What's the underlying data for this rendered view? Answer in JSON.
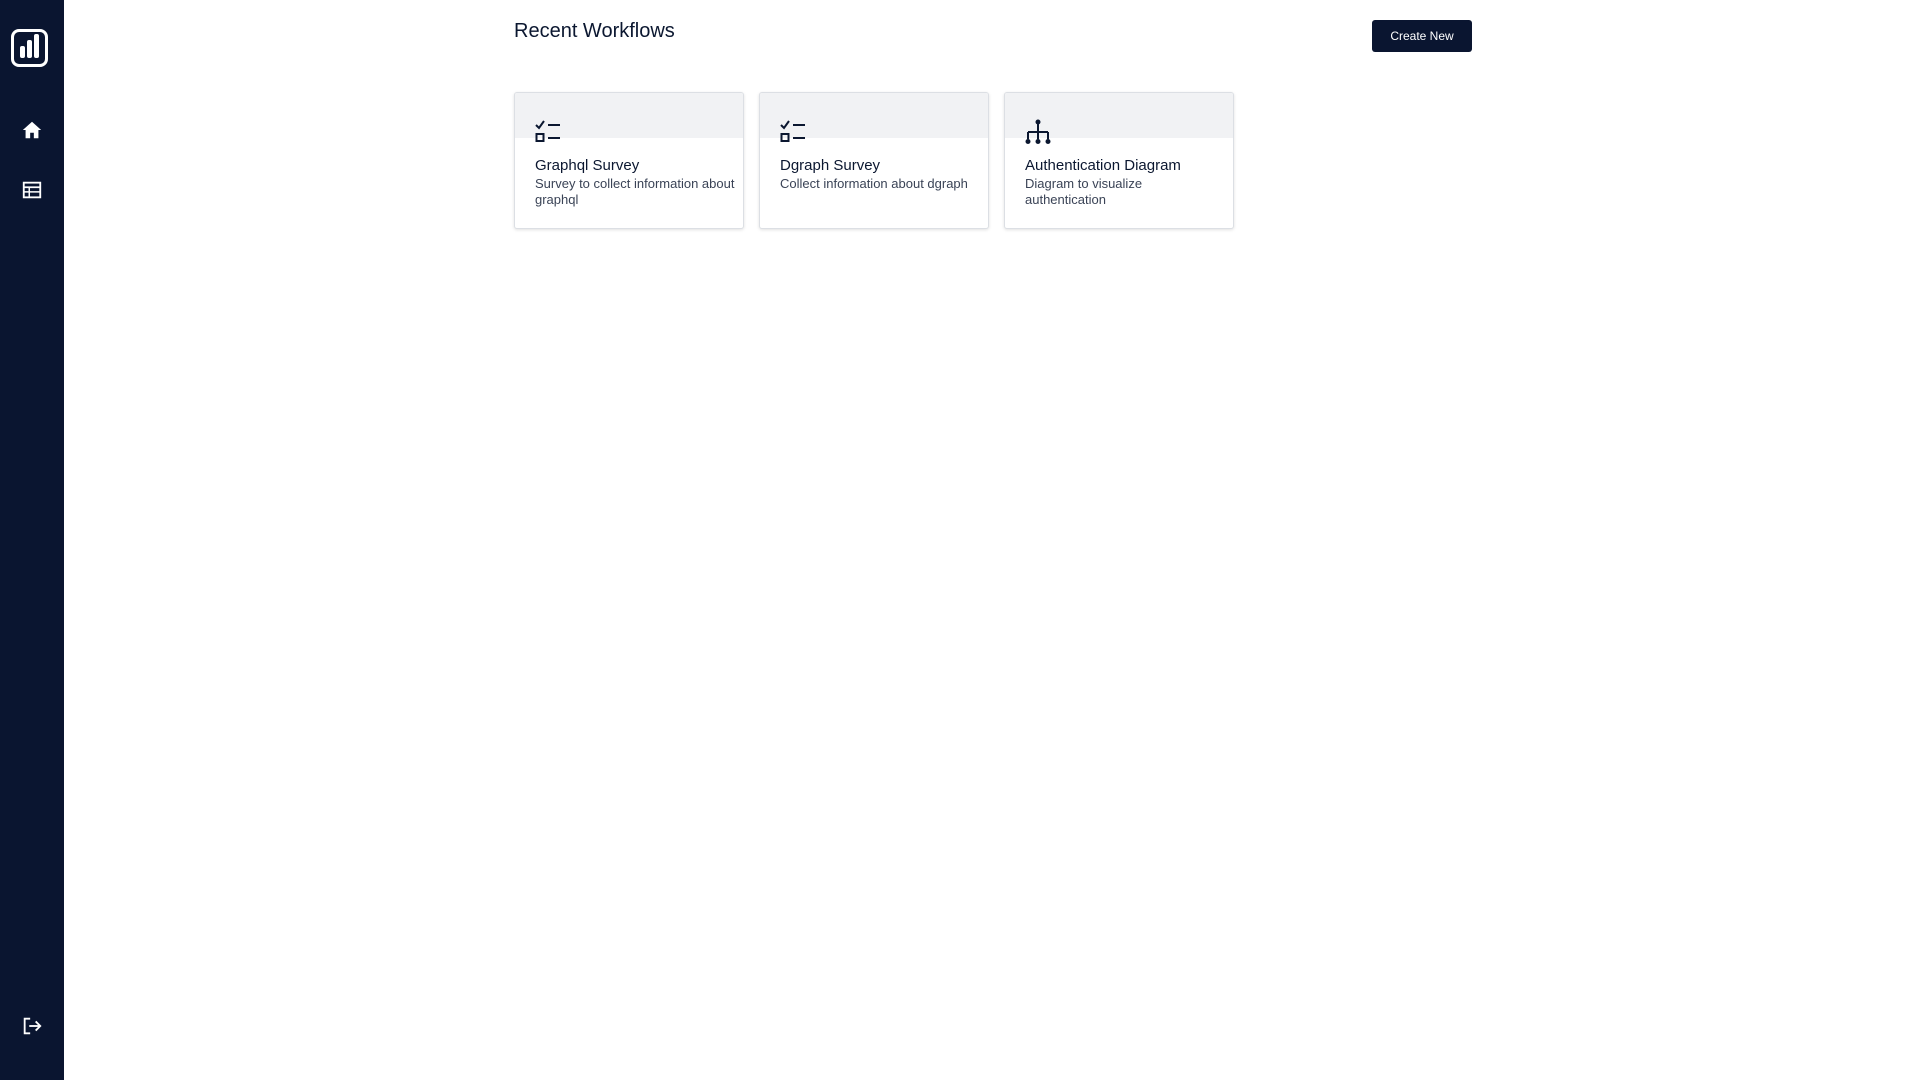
{
  "sidebar": {
    "logo_icon": "bar-chart-logo-icon",
    "items": [
      {
        "icon": "home-icon"
      },
      {
        "icon": "table-icon"
      }
    ],
    "logout_icon": "logout-icon"
  },
  "header": {
    "title": "Recent Workflows",
    "create_label": "Create New"
  },
  "workflows": [
    {
      "title": "Graphql Survey",
      "description": "Survey to collect information about graphql",
      "icon": "checklist-icon"
    },
    {
      "title": "Dgraph Survey",
      "description": "Collect information about dgraph",
      "icon": "checklist-icon"
    },
    {
      "title": "Authentication Diagram",
      "description": "Diagram to visualize authentication",
      "icon": "hierarchy-icon"
    }
  ],
  "colors": {
    "sidebar_bg": "#0a1530",
    "primary": "#0a1530",
    "card_header": "#f1f2f4",
    "text": "#0b1730"
  }
}
